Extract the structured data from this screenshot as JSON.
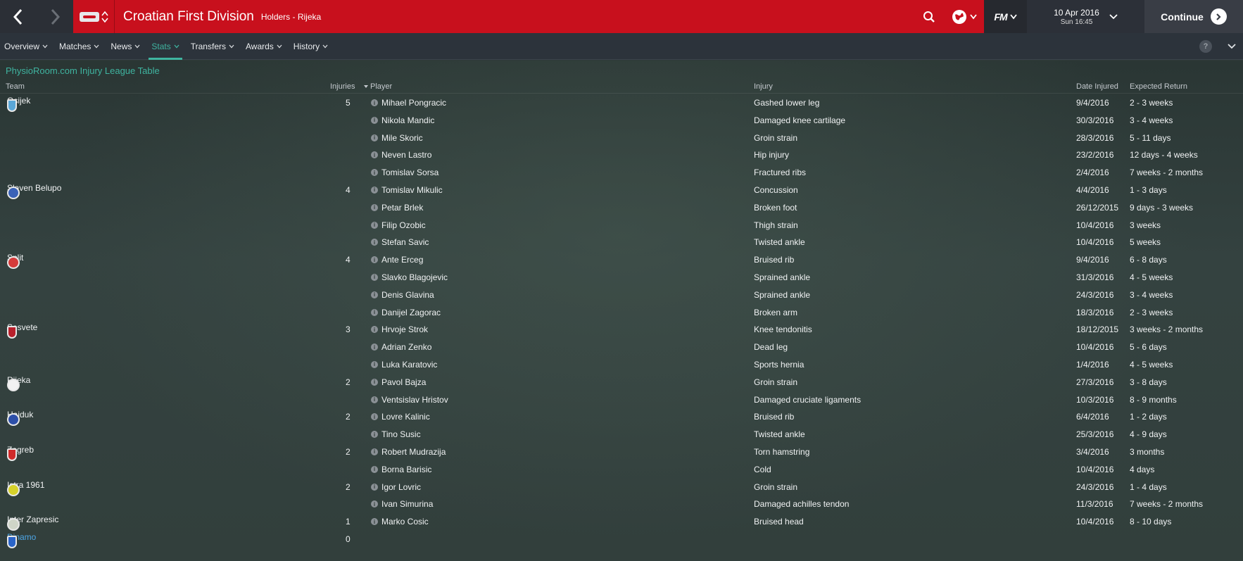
{
  "topbar": {
    "title": "Croatian First Division",
    "subtitle": "Holders - Rijeka",
    "date": "10 Apr 2016",
    "time": "Sun 16:45",
    "continue_label": "Continue",
    "fm_label": "FM"
  },
  "subnav": {
    "items": [
      {
        "label": "Overview"
      },
      {
        "label": "Matches"
      },
      {
        "label": "News"
      },
      {
        "label": "Stats"
      },
      {
        "label": "Transfers"
      },
      {
        "label": "Awards"
      },
      {
        "label": "History"
      }
    ],
    "active": "Stats",
    "help": "?"
  },
  "main": {
    "section_title": "PhysioRoom.com Injury League Table",
    "headers": {
      "team": "Team",
      "injuries": "Injuries",
      "player": "Player",
      "injury": "Injury",
      "date_injured": "Date Injured",
      "expected_return": "Expected Return"
    }
  },
  "teams": [
    {
      "name": "Osijek",
      "injuries": "5",
      "badge_color": "#5aa7d8"
    },
    {
      "name": "Slaven Belupo",
      "injuries": "4",
      "badge_color": "#3a62b8"
    },
    {
      "name": "Split",
      "injuries": "4",
      "badge_color": "#d53b3b"
    },
    {
      "name": "Sesvete",
      "injuries": "3",
      "badge_color": "#b8202c"
    },
    {
      "name": "Rijeka",
      "injuries": "2",
      "badge_color": "#f2f2f2"
    },
    {
      "name": "Hajduk",
      "injuries": "2",
      "badge_color": "#2d4fa8"
    },
    {
      "name": "Zagreb",
      "injuries": "2",
      "badge_color": "#cf2a2a"
    },
    {
      "name": "Istra 1961",
      "injuries": "2",
      "badge_color": "#d6d12a"
    },
    {
      "name": "Inter Zapresic",
      "injuries": "1",
      "badge_color": "#cfd5c8"
    },
    {
      "name": "Dinamo",
      "injuries": "0",
      "badge_color": "#2a64c8"
    }
  ],
  "injuries": [
    {
      "player": "Mihael Pongracic",
      "injury": "Gashed lower leg",
      "date": "9/4/2016",
      "return": "2 - 3 weeks"
    },
    {
      "player": "Nikola Mandic",
      "injury": "Damaged knee cartilage",
      "date": "30/3/2016",
      "return": "3 - 4 weeks"
    },
    {
      "player": "Mile Skoric",
      "injury": "Groin strain",
      "date": "28/3/2016",
      "return": "5 - 11 days"
    },
    {
      "player": "Neven Lastro",
      "injury": "Hip injury",
      "date": "23/2/2016",
      "return": "12 days - 4 weeks"
    },
    {
      "player": "Tomislav Sorsa",
      "injury": "Fractured ribs",
      "date": "2/4/2016",
      "return": "7 weeks - 2 months"
    },
    {
      "player": "Tomislav Mikulic",
      "injury": "Concussion",
      "date": "4/4/2016",
      "return": "1 - 3 days"
    },
    {
      "player": "Petar Brlek",
      "injury": "Broken foot",
      "date": "26/12/2015",
      "return": "9 days - 3 weeks"
    },
    {
      "player": "Filip Ozobic",
      "injury": "Thigh strain",
      "date": "10/4/2016",
      "return": "3 weeks"
    },
    {
      "player": "Stefan Savic",
      "injury": "Twisted ankle",
      "date": "10/4/2016",
      "return": "5 weeks"
    },
    {
      "player": "Ante Erceg",
      "injury": "Bruised rib",
      "date": "9/4/2016",
      "return": "6 - 8 days"
    },
    {
      "player": "Slavko Blagojevic",
      "injury": "Sprained ankle",
      "date": "31/3/2016",
      "return": "4 - 5 weeks"
    },
    {
      "player": "Denis Glavina",
      "injury": "Sprained ankle",
      "date": "24/3/2016",
      "return": "3 - 4 weeks"
    },
    {
      "player": "Danijel Zagorac",
      "injury": "Broken arm",
      "date": "18/3/2016",
      "return": "2 - 3 weeks"
    },
    {
      "player": "Hrvoje Strok",
      "injury": "Knee tendonitis",
      "date": "18/12/2015",
      "return": "3 weeks - 2 months"
    },
    {
      "player": "Adrian Zenko",
      "injury": "Dead leg",
      "date": "10/4/2016",
      "return": "5 - 6 days"
    },
    {
      "player": "Luka Karatovic",
      "injury": "Sports hernia",
      "date": "1/4/2016",
      "return": "4 - 5 weeks"
    },
    {
      "player": "Pavol Bajza",
      "injury": "Groin strain",
      "date": "27/3/2016",
      "return": "3 - 8 days"
    },
    {
      "player": "Ventsislav Hristov",
      "injury": "Damaged cruciate ligaments",
      "date": "10/3/2016",
      "return": "8 - 9 months"
    },
    {
      "player": "Lovre Kalinic",
      "injury": "Bruised rib",
      "date": "6/4/2016",
      "return": "1 - 2 days"
    },
    {
      "player": "Tino Susic",
      "injury": "Twisted ankle",
      "date": "25/3/2016",
      "return": "4 - 9 days"
    },
    {
      "player": "Robert Mudrazija",
      "injury": "Torn hamstring",
      "date": "3/4/2016",
      "return": "3 months"
    },
    {
      "player": "Borna Barisic",
      "injury": "Cold",
      "date": "10/4/2016",
      "return": "4 days"
    },
    {
      "player": "Igor Lovric",
      "injury": "Groin strain",
      "date": "24/3/2016",
      "return": "1 - 4 days"
    },
    {
      "player": "Ivan Simurina",
      "injury": "Damaged achilles tendon",
      "date": "11/3/2016",
      "return": "7 weeks - 2 months"
    },
    {
      "player": "Marko Cosic",
      "injury": "Bruised head",
      "date": "10/4/2016",
      "return": "8 - 10 days"
    }
  ],
  "colors": {
    "brand_red": "#c8101d",
    "accent_teal": "#3fb4a0",
    "link_blue": "#4da6e6"
  }
}
